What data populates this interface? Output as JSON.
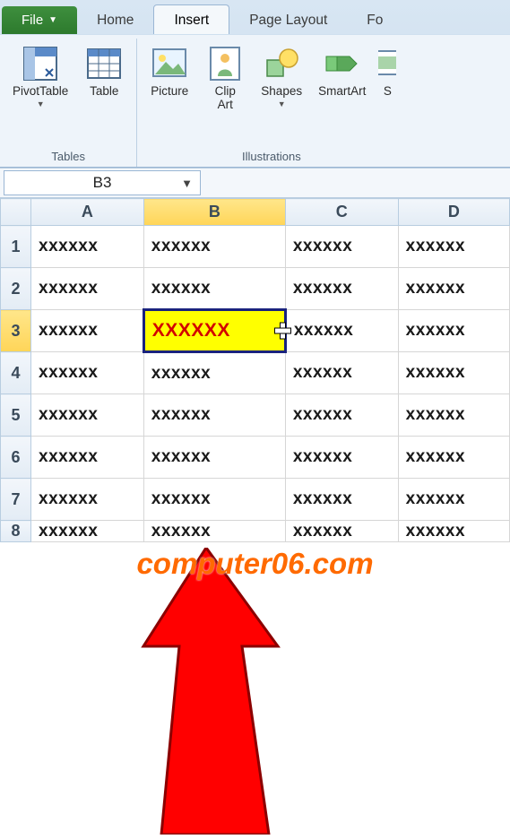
{
  "tabs": {
    "file": "File",
    "home": "Home",
    "insert": "Insert",
    "page_layout": "Page Layout",
    "formulas_partial": "Fo"
  },
  "ribbon": {
    "tables": {
      "label": "Tables",
      "pivot": "PivotTable",
      "table": "Table"
    },
    "illustrations": {
      "label": "Illustrations",
      "picture": "Picture",
      "clipart_line1": "Clip",
      "clipart_line2": "Art",
      "shapes": "Shapes",
      "smartart": "SmartArt",
      "screenshot_partial": "S"
    }
  },
  "namebox": {
    "value": "B3"
  },
  "columns": [
    "A",
    "B",
    "C",
    "D"
  ],
  "rows": [
    "1",
    "2",
    "3",
    "4",
    "5",
    "6",
    "7",
    "8"
  ],
  "selected_col": "B",
  "selected_row": "3",
  "cell_text": "xxxxxx",
  "selected_cell_text": "XXXXXX",
  "watermark": "computer06.com",
  "colors": {
    "accent": "#2d7a2d",
    "highlight": "#ffff00",
    "selection_border": "#1a237e",
    "selected_text": "#d20000",
    "arrow": "#ff0000",
    "watermark": "#ff6a00"
  }
}
